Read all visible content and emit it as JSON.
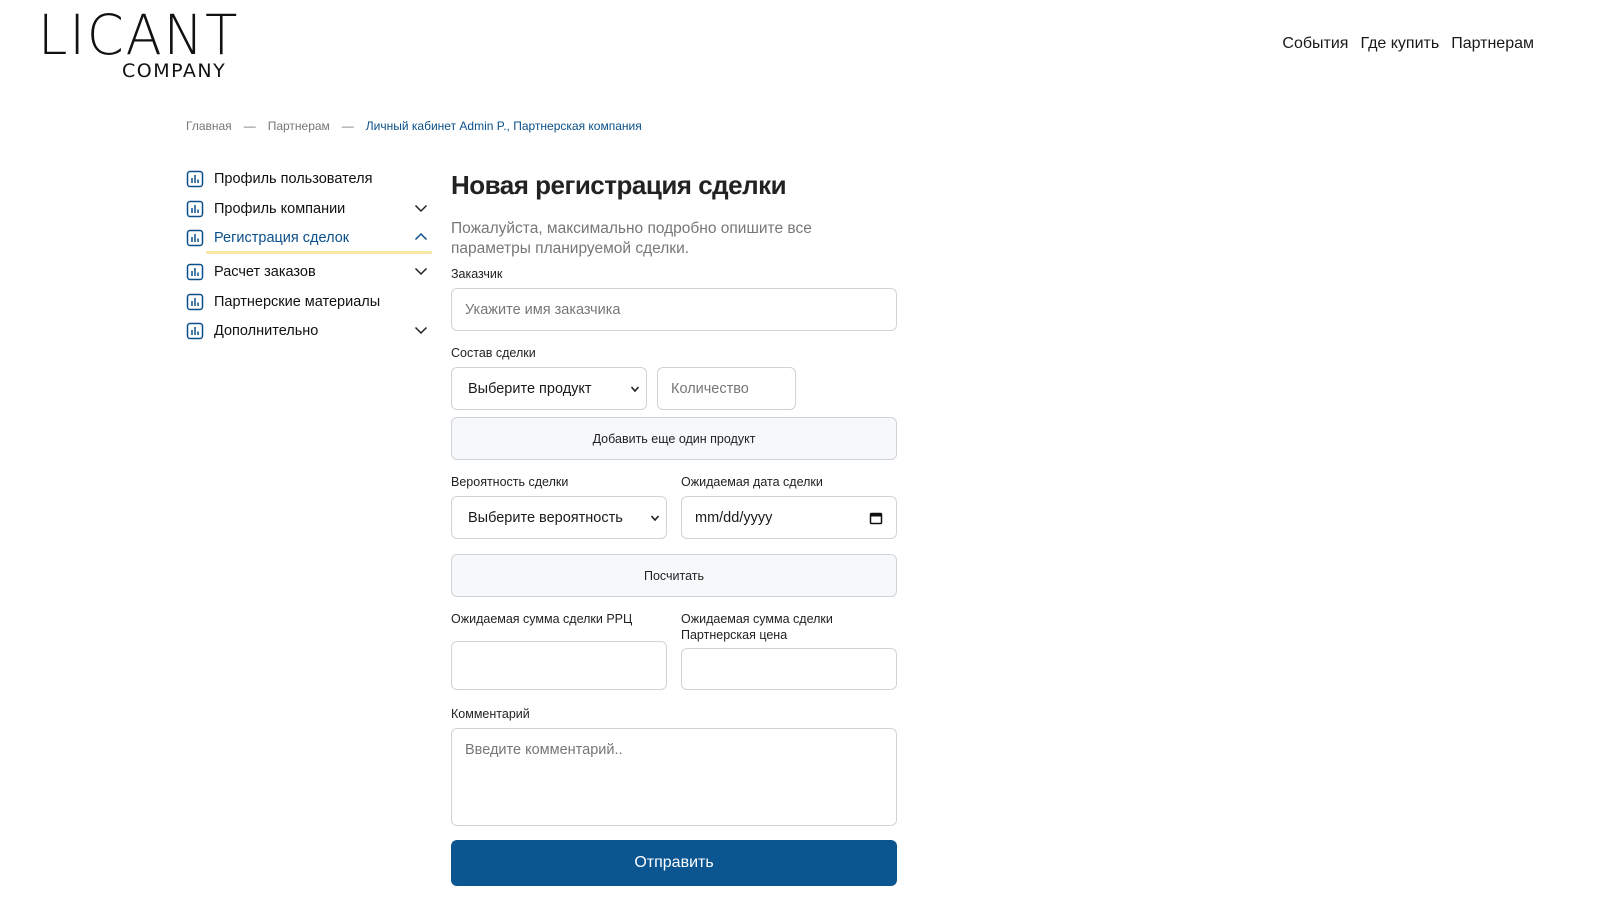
{
  "brand": {
    "name": "LICANT",
    "sub": "COMPANY"
  },
  "topnav": [
    "События",
    "Где купить",
    "Партнерам"
  ],
  "breadcrumb": {
    "home": "Главная",
    "partners": "Партнерам",
    "current": "Личный кабинет Admin P., Партнерская компания",
    "separator": "—"
  },
  "sidebar": {
    "items": [
      {
        "label": "Профиль пользователя",
        "expandable": false,
        "active": false
      },
      {
        "label": "Профиль компании",
        "expandable": true,
        "active": false
      },
      {
        "label": "Регистрация сделок",
        "expandable": true,
        "active": true,
        "expanded": true
      },
      {
        "label": "Расчет заказов",
        "expandable": true,
        "active": false
      },
      {
        "label": "Партнерские материалы",
        "expandable": false,
        "active": false
      },
      {
        "label": "Дополнительно",
        "expandable": true,
        "active": false
      }
    ],
    "icon": "bar-chart-icon",
    "accent_color": "#0b4f8a",
    "active_underline_color": "#f7e8a8"
  },
  "form": {
    "title": "Новая регистрация сделки",
    "subtitle": "Пожалуйста, максимально подробно опишите все параметры планируемой сделки.",
    "customer_label": "Заказчик",
    "customer_placeholder": "Укажите имя заказчика",
    "composition_label": "Состав сделки",
    "product_select": "Выберите продукт",
    "quantity_placeholder": "Количество",
    "add_product_button": "Добавить еще один продукт",
    "probability_label": "Вероятность сделки",
    "probability_select": "Выберите вероятность",
    "date_label": "Ожидаемая дата сделки",
    "date_placeholder": "mm/dd/yyyy",
    "calculate_button": "Посчитать",
    "sum_rrp_label": "Ожидаемая сумма сделки РРЦ",
    "sum_partner_label_line1": "Ожидаемая сумма сделки",
    "sum_partner_label_line2": "Партнерская цена",
    "comment_label": "Комментарий",
    "comment_placeholder": "Введите комментарий..",
    "submit_button": "Отправить",
    "primary_color": "#0b5591"
  }
}
